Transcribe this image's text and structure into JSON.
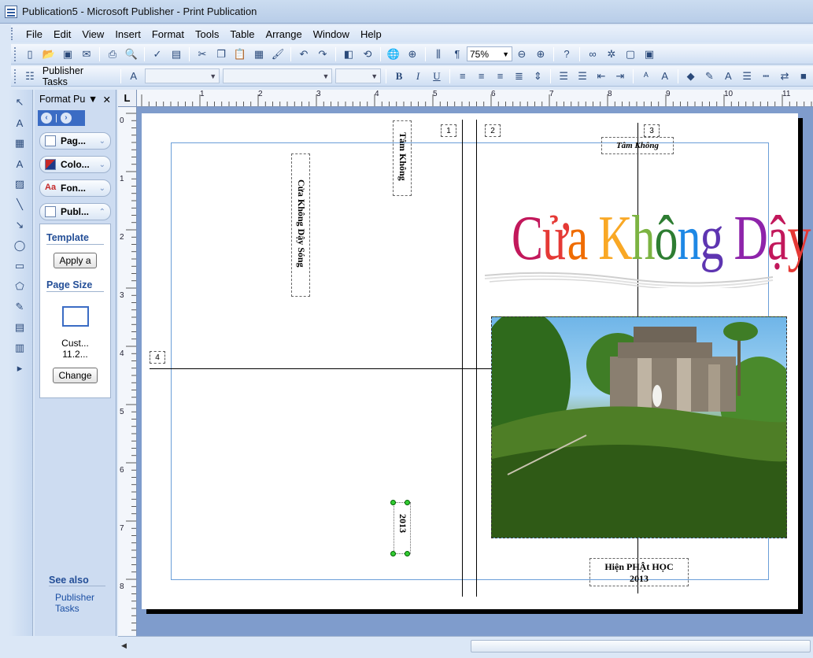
{
  "window": {
    "title": "Publication5 - Microsoft Publisher - Print Publication"
  },
  "menu": [
    "File",
    "Edit",
    "View",
    "Insert",
    "Format",
    "Tools",
    "Table",
    "Arrange",
    "Window",
    "Help"
  ],
  "toolbar": {
    "zoom": "75%"
  },
  "formatting": {
    "tasks_label": "Publisher Tasks",
    "bold": "B",
    "italic": "I",
    "underline": "U"
  },
  "taskpane": {
    "title": "Format Pu",
    "sections": [
      "Pag...",
      "Colo...",
      "Fon...",
      "Publ..."
    ],
    "template_heading": "Template",
    "apply_button": "Apply a",
    "pagesize_heading": "Page Size",
    "pagesize_name": "Cust...",
    "pagesize_dims": "11.2...",
    "change_button": "Change",
    "see_also": "See also",
    "see_also_link": "Publisher Tasks"
  },
  "ruler": {
    "corner": "L",
    "h_numbers": [
      "1",
      "2",
      "3",
      "4",
      "5",
      "6",
      "7",
      "8",
      "9",
      "10",
      "11"
    ],
    "v_numbers": [
      "0",
      "1",
      "2",
      "3",
      "4",
      "5",
      "6",
      "7",
      "8"
    ]
  },
  "page": {
    "page_numbers": [
      "1",
      "2",
      "3",
      "4"
    ],
    "spine_author": "Tâm Không",
    "back_title_vertical": "Cửa Không Dậy Sóng",
    "spine_year": "2013",
    "front_author": "Tâm Không",
    "wordart_title": "Cửa Không Dậy Sóng",
    "publisher_line1": "Hiện PHẬt HỌC",
    "publisher_line2": "2013"
  },
  "colors": {
    "wordart": [
      "#c2185b",
      "#e53935",
      "#ef6c00",
      "#f9a825",
      "#7cb342",
      "#2e7d32",
      "#1e88e5",
      "#5e35b1",
      "#8e24aa"
    ]
  }
}
